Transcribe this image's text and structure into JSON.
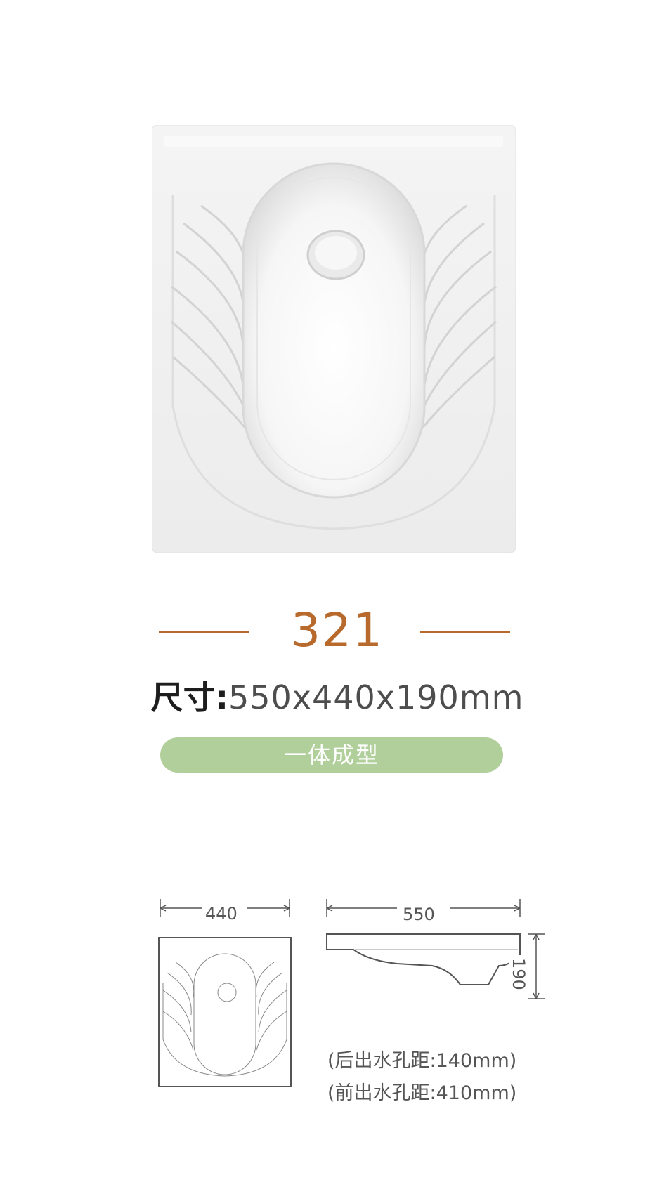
{
  "product": {
    "model_number": "321",
    "size_label": "尺寸:",
    "size_value": "550x440x190mm",
    "feature": "一体成型"
  },
  "drawing": {
    "width_dim": "440",
    "length_dim": "550",
    "height_dim": "190",
    "note_rear": "(后出水孔距:140mm)",
    "note_front": "(前出水孔距:410mm)"
  },
  "colors": {
    "accent": "#b86a2d",
    "pill": "#b1cf9b",
    "line": "#555555"
  }
}
